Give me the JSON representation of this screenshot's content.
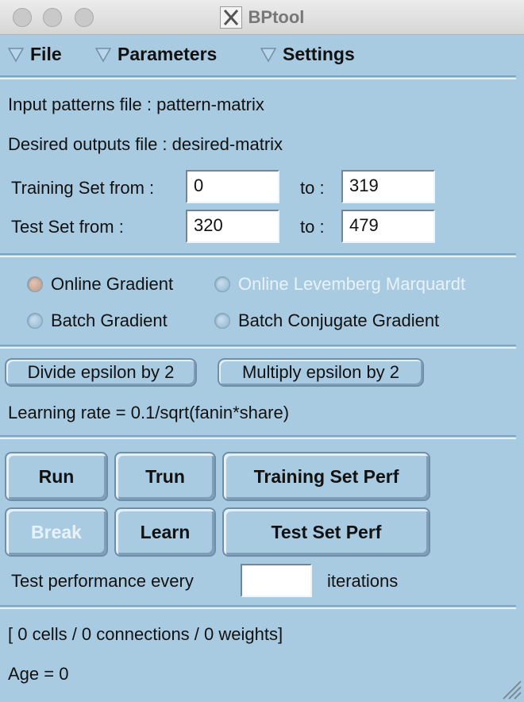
{
  "window": {
    "title": "BPtool"
  },
  "menu": {
    "file": "File",
    "parameters": "Parameters",
    "settings": "Settings"
  },
  "files": {
    "input_label": "Input patterns file :",
    "input_value": "pattern-matrix",
    "desired_label": "Desired outputs file :",
    "desired_value": "desired-matrix"
  },
  "sets": {
    "training_label": "Training Set from :",
    "training_from": "0",
    "training_to_label": "to :",
    "training_to": "319",
    "test_label": "Test Set from :",
    "test_from": "320",
    "test_to_label": "to :",
    "test_to": "479"
  },
  "algorithms": {
    "online_gradient": "Online Gradient",
    "online_lm": "Online Levemberg Marquardt",
    "batch_gradient": "Batch Gradient",
    "batch_cg": "Batch Conjugate Gradient",
    "selected": "online_gradient"
  },
  "epsilon": {
    "divide_label": "Divide epsilon by 2",
    "multiply_label": "Multiply epsilon by 2",
    "learning_rate": "Learning rate = 0.1/sqrt(fanin*share)"
  },
  "actions": {
    "run": "Run",
    "trun": "Trun",
    "training_perf": "Training Set Perf",
    "break": "Break",
    "learn": "Learn",
    "test_perf": "Test Set Perf"
  },
  "performance": {
    "label_before": "Test performance every",
    "interval_value": "",
    "label_after": "iterations"
  },
  "status": {
    "network": "[ 0 cells / 0 connections / 0 weights]",
    "age": "Age = 0"
  },
  "colors": {
    "background": "#a9cbe2",
    "disabled_text": "#e8f2fa",
    "selected_radio": "#c8a898"
  }
}
